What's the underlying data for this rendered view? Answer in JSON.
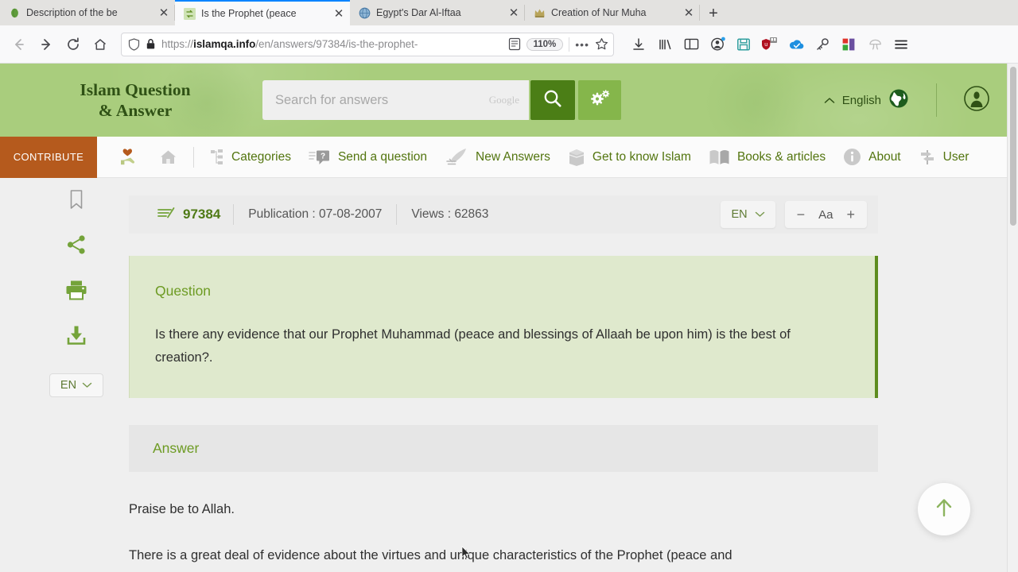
{
  "browser": {
    "tabs": [
      {
        "title": "Description of the be",
        "favicon": "green-leaf-icon",
        "active": false
      },
      {
        "title": "Is the Prophet (peace",
        "favicon": "islamqa-icon",
        "active": true
      },
      {
        "title": "Egypt's Dar Al-Iftaa",
        "favicon": "globe-icon",
        "active": false
      },
      {
        "title": "Creation of Nur Muha",
        "favicon": "crown-icon",
        "active": false
      }
    ],
    "new_tab_label": "+",
    "close_label": "✕",
    "nav": {
      "back": "back-button",
      "forward": "forward-button",
      "reload": "reload-button",
      "home": "home-button"
    },
    "url": {
      "scheme": "https://",
      "domain": "islamqa.info",
      "path": "/en/answers/97384/is-the-prophet-",
      "zoom": "110%",
      "shield": "tracking-protection-icon",
      "lock": "lock-icon",
      "reader": "reader-view-icon",
      "more": "•••",
      "bookmark": "☆"
    },
    "toolbar_icons": [
      "downloads-icon",
      "library-icon",
      "sidebar-icon",
      "account-icon",
      "save-page-icon",
      "ublock-icon",
      "onedrive-icon",
      "key-icon",
      "extension-icon",
      "mushroom-icon",
      "menu-icon"
    ]
  },
  "site": {
    "logo_line1": "Islam Question",
    "logo_line2": "& Answer",
    "search": {
      "placeholder": "Search for answers",
      "value": "",
      "google_mark": "Google",
      "search_icon": "magnifier-icon",
      "settings_icon": "gears-icon"
    },
    "language": {
      "label": "English",
      "chevron": "chevron-up-icon",
      "globe_icon": "globe-icon"
    },
    "account_icon": "user-avatar-icon"
  },
  "nav": {
    "contribute_label": "CONTRIBUTE",
    "donate_icon": "hand-heart-icon",
    "home_icon": "home-icon",
    "items": [
      {
        "label": "Categories",
        "icon": "sitemap-icon"
      },
      {
        "label": "Send a question",
        "icon": "question-bubble-icon"
      },
      {
        "label": "New Answers",
        "icon": "quill-icon"
      },
      {
        "label": "Get to know Islam",
        "icon": "kaaba-icon"
      },
      {
        "label": "Books & articles",
        "icon": "book-icon"
      },
      {
        "label": "About",
        "icon": "info-icon"
      },
      {
        "label": "User",
        "icon": "signpost-icon"
      }
    ]
  },
  "sidebar_tools": [
    {
      "name": "bookmark-icon"
    },
    {
      "name": "share-icon"
    },
    {
      "name": "print-icon"
    },
    {
      "name": "download-icon"
    }
  ],
  "sidebar_lang": {
    "label": "EN",
    "chevron": "chevron-down-icon"
  },
  "article": {
    "id": "97384",
    "id_icon": "document-lines-icon",
    "publication_label": "Publication : 07-08-2007",
    "views_label": "Views : 62863",
    "lang_button": {
      "label": "EN",
      "chevron": "chevron-down-icon"
    },
    "font_controls": {
      "minus": "−",
      "label": "Aa",
      "plus": "+"
    },
    "question": {
      "heading": "Question",
      "text": "Is there any evidence that our Prophet Muhammad (peace and blessings of Allaah be upon him) is the best of creation?."
    },
    "answer": {
      "heading": "Answer",
      "paragraphs": [
        "Praise be to Allah.",
        "There is a great deal of evidence about the virtues and unique characteristics of the Prophet (peace and"
      ]
    }
  },
  "scroll_top_button": {
    "name": "scroll-to-top-button",
    "icon": "arrow-up-icon"
  },
  "colors": {
    "header_green": "#a9cd7d",
    "accent_green": "#4b7e16",
    "nav_green": "#53750f",
    "contribute_orange": "#b55a1d",
    "question_bg": "#dfe9cd",
    "question_border": "#5d8c1e"
  }
}
